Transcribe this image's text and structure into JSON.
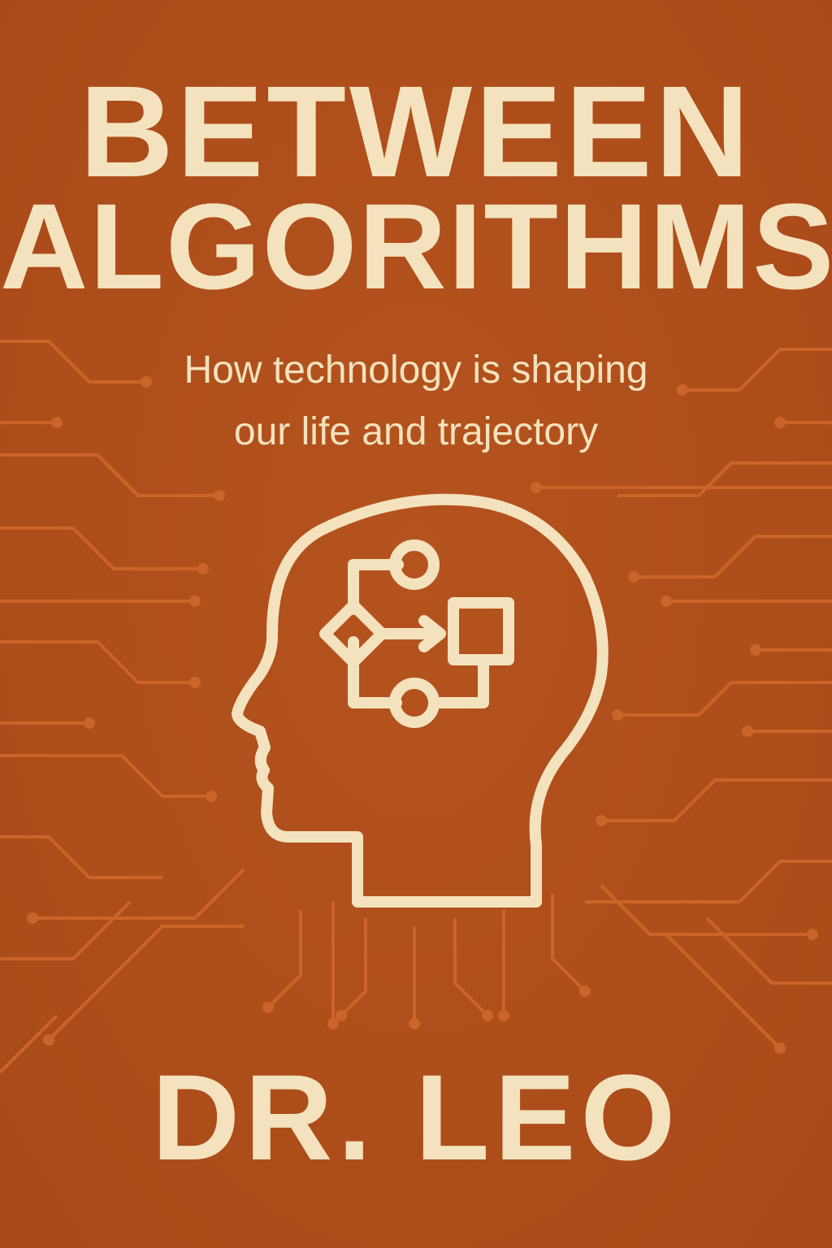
{
  "cover": {
    "title_line_1": "BETWEEN",
    "title_line_2": "ALGORITHMS",
    "subtitle_line_1": "How technology is shaping",
    "subtitle_line_2": "our life and trajectory",
    "author": "DR. LEO"
  },
  "icons": {
    "head": "head-with-flowchart-icon",
    "background": "circuit-lines-pattern"
  },
  "colors": {
    "background": "#b5531e",
    "background_dark": "#a84a18",
    "text": "#f3e2bd",
    "circuit": "#c8652a"
  }
}
